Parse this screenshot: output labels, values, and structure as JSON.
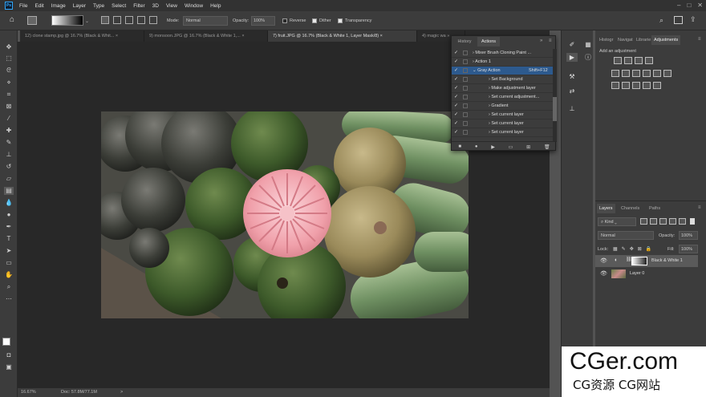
{
  "app": {
    "logo_text": "Ps"
  },
  "menu": [
    "File",
    "Edit",
    "Image",
    "Layer",
    "Type",
    "Select",
    "Filter",
    "3D",
    "View",
    "Window",
    "Help"
  ],
  "options": {
    "mode_label": "Mode:",
    "mode_value": "Normal",
    "opacity_label": "Opacity:",
    "opacity_value": "100%",
    "reverse_label": "Reverse",
    "dither_label": "Dither",
    "transparency_label": "Transparency"
  },
  "tabs": [
    {
      "label": "12) clone stamp.jpg @ 16.7% (Black & Whit...",
      "close": "×"
    },
    {
      "label": "9) monsoon.JPG @ 16.7% (Black & White 1,...",
      "close": "×"
    },
    {
      "label": "7) fruit.JPG @ 16.7% (Black & White 1, Layer Mask/8)",
      "close": "×"
    },
    {
      "label": "4) magic wa",
      "close": "»"
    }
  ],
  "status": {
    "zoom": "16.67%",
    "doc": "Doc: 57.8M/77.1M",
    "arrow": ">"
  },
  "actions_panel": {
    "tabs": [
      "History",
      "Actions"
    ],
    "rows": [
      {
        "label": "Mixer Brush Cloning Paint ...",
        "indent": 0,
        "shortcut": ""
      },
      {
        "label": "Action 1",
        "indent": 0,
        "shortcut": ""
      },
      {
        "label": "Gray Action",
        "indent": 0,
        "shortcut": "Shift+F12",
        "selected": true
      },
      {
        "label": "Set Background",
        "indent": 1,
        "shortcut": ""
      },
      {
        "label": "Make adjustment layer",
        "indent": 1,
        "shortcut": ""
      },
      {
        "label": "Set current adjustment...",
        "indent": 1,
        "shortcut": ""
      },
      {
        "label": "Gradient",
        "indent": 1,
        "shortcut": ""
      },
      {
        "label": "Set current layer",
        "indent": 1,
        "shortcut": ""
      },
      {
        "label": "Set current layer",
        "indent": 1,
        "shortcut": ""
      },
      {
        "label": "Set current layer",
        "indent": 1,
        "shortcut": ""
      }
    ]
  },
  "right_panel": {
    "top_tabs": [
      "Histogr",
      "Navigat",
      "Librarie",
      "Adjustments"
    ],
    "add_adjustment": "Add an adjustment",
    "layers_tabs": [
      "Layers",
      "Channels",
      "Paths"
    ],
    "kind_label": "Kind",
    "blend_mode": "Normal",
    "opacity_label": "Opacity:",
    "opacity_value": "100%",
    "lock_label": "Lock:",
    "fill_label": "Fill:",
    "fill_value": "100%",
    "layers": [
      {
        "name": "Black & White 1",
        "selected": true
      },
      {
        "name": "Layer 0",
        "selected": false
      }
    ]
  },
  "watermark": {
    "title": "CGer.com",
    "subtitle": "CG资源 CG网站"
  }
}
